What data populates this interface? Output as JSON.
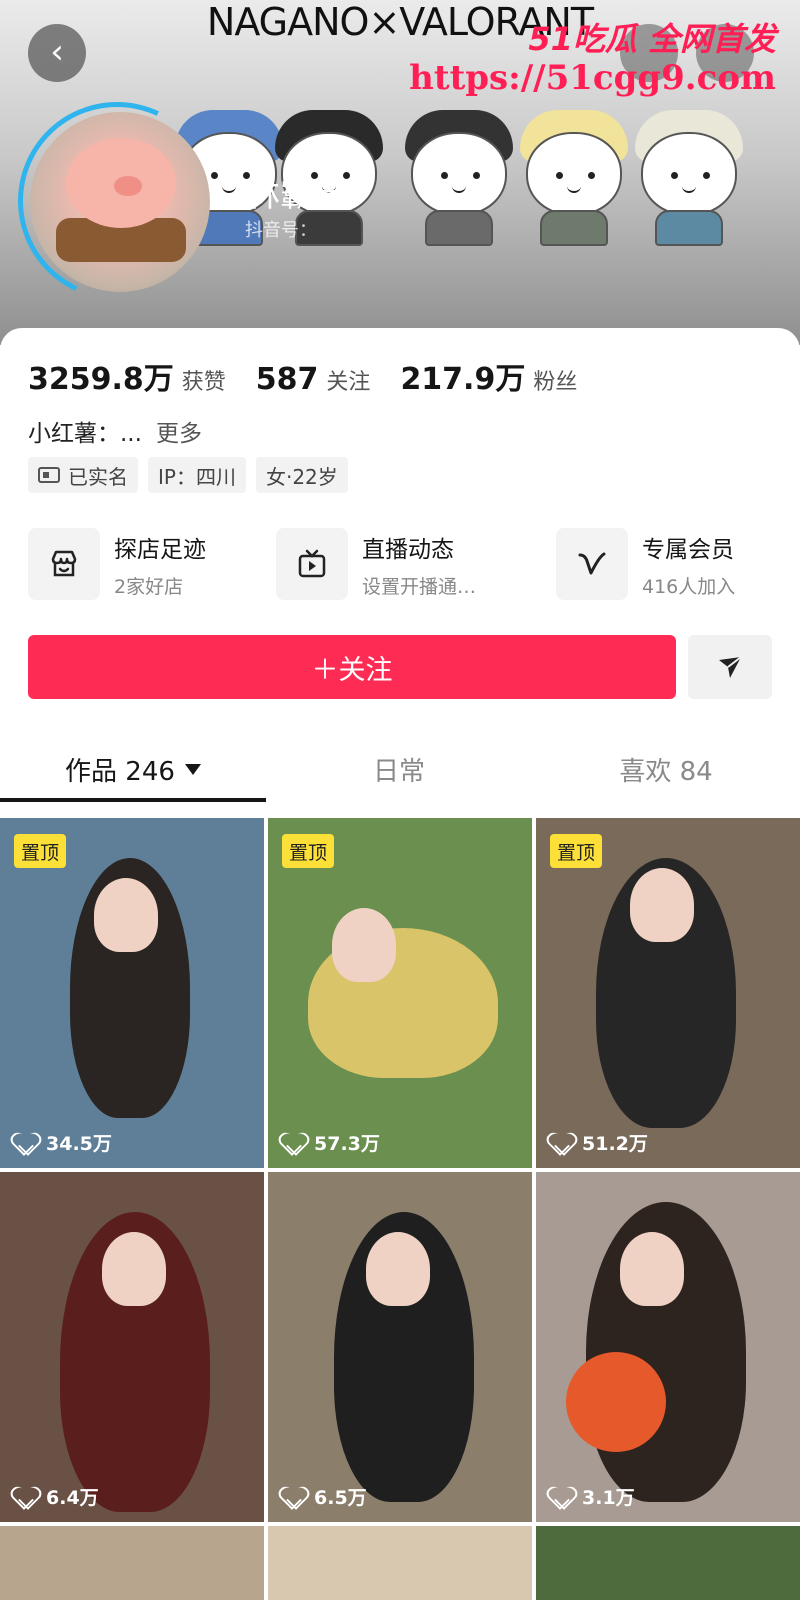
{
  "banner": {
    "title": "NAGANO×VALORANT",
    "watermark_line1": "51吃瓜 全网首发",
    "watermark_url": "https://51cgg9.com"
  },
  "profile": {
    "nickname": "林霸天",
    "account_id_prefix": "抖音号："
  },
  "stats": [
    {
      "value": "3259.8万",
      "label": "获赞"
    },
    {
      "value": "587",
      "label": "关注"
    },
    {
      "value": "217.9万",
      "label": "粉丝"
    }
  ],
  "bio": {
    "text": "小红薯：...",
    "more": "更多"
  },
  "tags": [
    "已实名",
    "IP：四川",
    "女·22岁"
  ],
  "features": [
    {
      "title": "探店足迹",
      "subtitle": "2家好店",
      "icon": "shop-icon"
    },
    {
      "title": "直播动态",
      "subtitle": "设置开播通…",
      "icon": "tv-icon"
    },
    {
      "title": "专属会员",
      "subtitle": "416人加入",
      "icon": "vip-v-icon"
    }
  ],
  "actions": {
    "follow_label": "＋关注"
  },
  "tabs": [
    {
      "label": "作品 246",
      "active": true
    },
    {
      "label": "日常",
      "active": false
    },
    {
      "label": "喜欢 84",
      "active": false
    }
  ],
  "videos": [
    {
      "pinned": true,
      "pin_label": "置顶",
      "likes": "34.5万",
      "bg": "#5e7f97"
    },
    {
      "pinned": true,
      "pin_label": "置顶",
      "likes": "57.3万",
      "bg": "#6b8f4e"
    },
    {
      "pinned": true,
      "pin_label": "置顶",
      "likes": "51.2万",
      "bg": "#7a6a5a"
    },
    {
      "pinned": false,
      "likes": "6.4万",
      "bg": "#6a5146"
    },
    {
      "pinned": false,
      "likes": "6.5万",
      "bg": "#8b7f6c"
    },
    {
      "pinned": false,
      "likes": "3.1万",
      "bg": "#a79b93"
    }
  ]
}
